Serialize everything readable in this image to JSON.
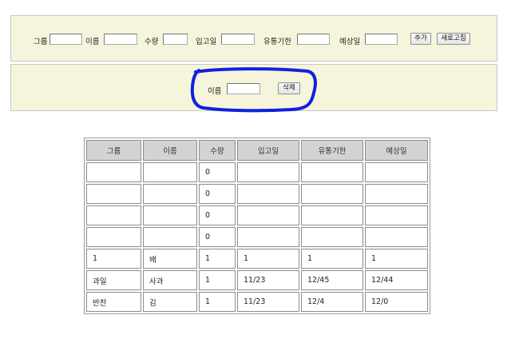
{
  "add_form": {
    "group_label": "그룹",
    "name_label": "이름",
    "qty_label": "수량",
    "in_date_label": "입고일",
    "expiry_label": "유통기한",
    "expected_label": "예상일",
    "add_button": "추가",
    "refresh_button": "새로고침",
    "group_value": "",
    "name_value": "",
    "qty_value": "",
    "in_date_value": "",
    "expiry_value": "",
    "expected_value": ""
  },
  "delete_form": {
    "name_label": "이름",
    "name_value": "",
    "delete_button": "삭제"
  },
  "annotation": {
    "color": "#1020e0",
    "shape": "hand-drawn-circle"
  },
  "table": {
    "headers": [
      "그룹",
      "이름",
      "수량",
      "입고일",
      "유통기한",
      "예상일"
    ],
    "rows": [
      [
        "",
        "",
        "0",
        "",
        "",
        ""
      ],
      [
        "",
        "",
        "0",
        "",
        "",
        ""
      ],
      [
        "",
        "",
        "0",
        "",
        "",
        ""
      ],
      [
        "",
        "",
        "0",
        "",
        "",
        ""
      ],
      [
        "1",
        "배",
        "1",
        "1",
        "1",
        "1"
      ],
      [
        "과일",
        "사과",
        "1",
        "11/23",
        "12/45",
        "12/44"
      ],
      [
        "반찬",
        "김",
        "1",
        "11/23",
        "12/4",
        "12/0"
      ]
    ]
  }
}
